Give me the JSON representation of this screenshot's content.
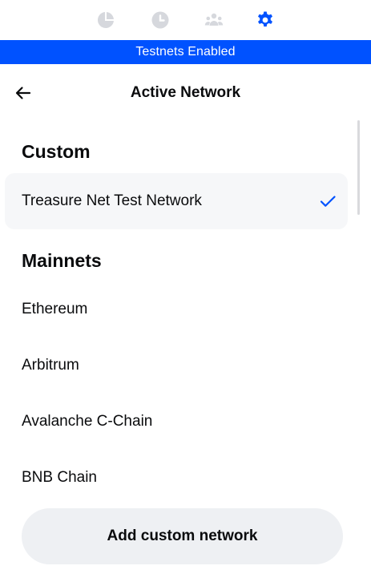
{
  "nav_tabs": [
    {
      "icon": "pie-chart-icon",
      "active": false
    },
    {
      "icon": "clock-icon",
      "active": false
    },
    {
      "icon": "people-icon",
      "active": false
    },
    {
      "icon": "gear-icon",
      "active": true
    }
  ],
  "banner": {
    "text": "Testnets Enabled"
  },
  "header": {
    "title": "Active Network",
    "back_icon": "arrow-left-icon"
  },
  "sections": {
    "custom": {
      "heading": "Custom",
      "items": [
        {
          "label": "Treasure Net Test Network",
          "selected": true
        }
      ]
    },
    "mainnets": {
      "heading": "Mainnets",
      "items": [
        {
          "label": "Ethereum"
        },
        {
          "label": "Arbitrum"
        },
        {
          "label": "Avalanche C-Chain"
        },
        {
          "label": "BNB Chain"
        }
      ]
    }
  },
  "add_button": {
    "label": "Add custom network"
  },
  "colors": {
    "accent": "#0052ff",
    "inactive_icon": "#d6d8dd",
    "selected_row_bg": "#f6f7f9",
    "button_bg": "#eef0f3"
  }
}
